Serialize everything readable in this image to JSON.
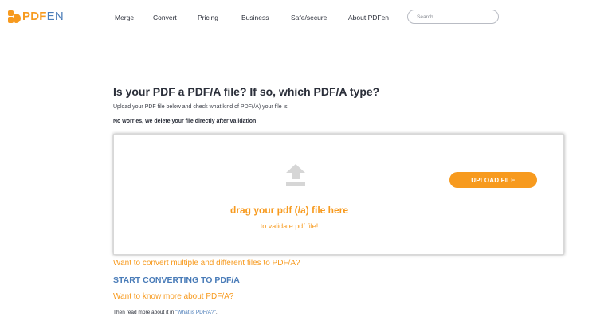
{
  "brand": {
    "logo_pdf": "PDF",
    "logo_en": "EN",
    "accent": "#f79a1e",
    "link_color": "#4a7cb8"
  },
  "nav": {
    "items": [
      {
        "label": "Merge"
      },
      {
        "label": "Convert"
      },
      {
        "label": "Pricing"
      },
      {
        "label": "Business"
      },
      {
        "label": "Safe/secure"
      },
      {
        "label": "About PDFen"
      }
    ],
    "search_placeholder": "Search ..."
  },
  "main": {
    "title": "Is your PDF a PDF/A file? If so, which PDF/A type?",
    "intro": "Upload your PDF file below and check what kind of PDF(/A) your file is.",
    "notice": "No worries, we delete your file directly after validation!",
    "dropzone": {
      "icon": "upload-arrow-icon",
      "drag_text": "drag your pdf (/a) file here",
      "validate_text": "to validate pdf file!",
      "upload_button": "UPLOAD FILE"
    },
    "question_convert": "Want to convert multiple and different files to PDF/A?",
    "cta_convert": "START CONVERTING TO PDF/A",
    "question_more": "Want to know more about PDF/A?",
    "readmore_prefix": "Then read more about it in ",
    "readmore_link": "\"What is PDF/A?\"",
    "readmore_suffix": "."
  }
}
